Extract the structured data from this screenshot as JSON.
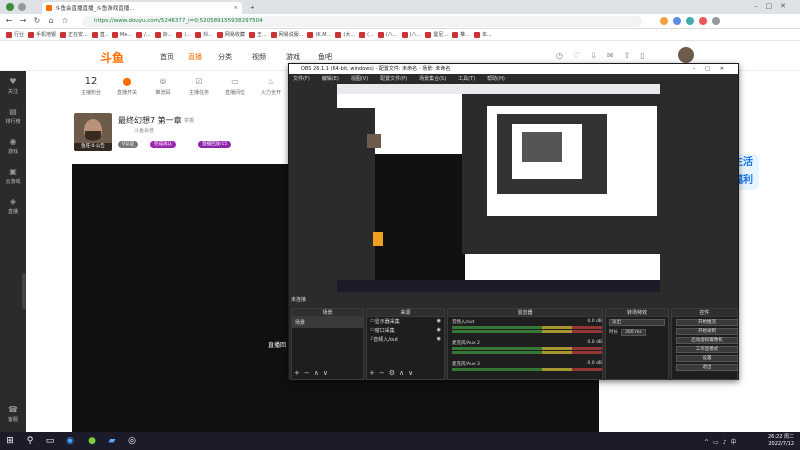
{
  "browser": {
    "tabs": [
      {
        "label": "斗鱼会直播直播_斗鱼游戏直播..."
      },
      {
        "label": "×"
      },
      {
        "label": "+"
      }
    ],
    "url": "https://www.douyu.com/5246377_i=0;520589155938297504",
    "bookmarks": [
      "行业",
      "手机地银",
      "正在安...",
      "直..",
      "Me...",
      "/...",
      "杂...",
      "(...",
      "抖...",
      "网易收藏",
      "王...",
      "网易说服...",
      "(K.M...",
      "(大...",
      "(...",
      "(八...",
      "(八...",
      "曼尼...",
      "推...",
      "本..."
    ]
  },
  "douyu": {
    "logo": "斗鱼",
    "nav": [
      "首页",
      "直播",
      "分类",
      "视频",
      "游戏",
      "鱼吧"
    ],
    "sidebar": [
      "关注",
      "排行榜",
      "游戏",
      "云游戏",
      "直播",
      "客服"
    ],
    "stats": [
      {
        "top": "12",
        "label": "主播粉丝"
      },
      {
        "top": "",
        "label": "直播开关"
      },
      {
        "top": "",
        "label": "推流码"
      },
      {
        "top": "",
        "label": "主播任务"
      },
      {
        "top": "",
        "label": "直播间位"
      },
      {
        "top": "",
        "label": "火力全开"
      }
    ],
    "streamer": {
      "title": "最终幻想7 第一章",
      "tag": "举报",
      "sub": "斗鱼会普",
      "avatar_caption": "鱼旺·0·公告",
      "badges": [
        "V认证",
        "完成再认",
        "直播回放/15"
      ]
    },
    "left_label": "直播回",
    "float_badge": "超级福利"
  },
  "obs": {
    "title": "OBS 26.1.1 (64-bit, windows) - 配置文件: 未命名 - 场景: 未命名",
    "menu": [
      "文件(F)",
      "编辑(E)",
      "视图(V)",
      "配置文件(P)",
      "场景集合(S)",
      "工具(T)",
      "帮助(H)"
    ],
    "nested_caption": "未连接",
    "docks": {
      "scenes": {
        "header": "场景",
        "items": [
          "场景"
        ]
      },
      "sources": {
        "header": "来源",
        "items": [
          "显示器采集",
          "窗口采集",
          "音频入/out"
        ]
      },
      "mixer": {
        "header": "混音器",
        "rows": [
          {
            "name": "音频入/out",
            "db": "0.0 dB"
          },
          {
            "name": "麦克风/Aux 2",
            "db": "0.0 dB"
          },
          {
            "name": "麦克风/Aux 3",
            "db": "0.0 dB"
          }
        ]
      },
      "transitions": {
        "header": "转场特效",
        "type": "淡出",
        "duration_label": "时长",
        "duration": "300 ms"
      },
      "controls": {
        "header": "控件",
        "buttons": [
          "开始推流",
          "开始录制",
          "启动虚拟摄像机",
          "工作室模式",
          "设置",
          "退出"
        ]
      }
    }
  },
  "taskbar": {
    "time": "26:22 周二",
    "date": "2022/7/12"
  }
}
